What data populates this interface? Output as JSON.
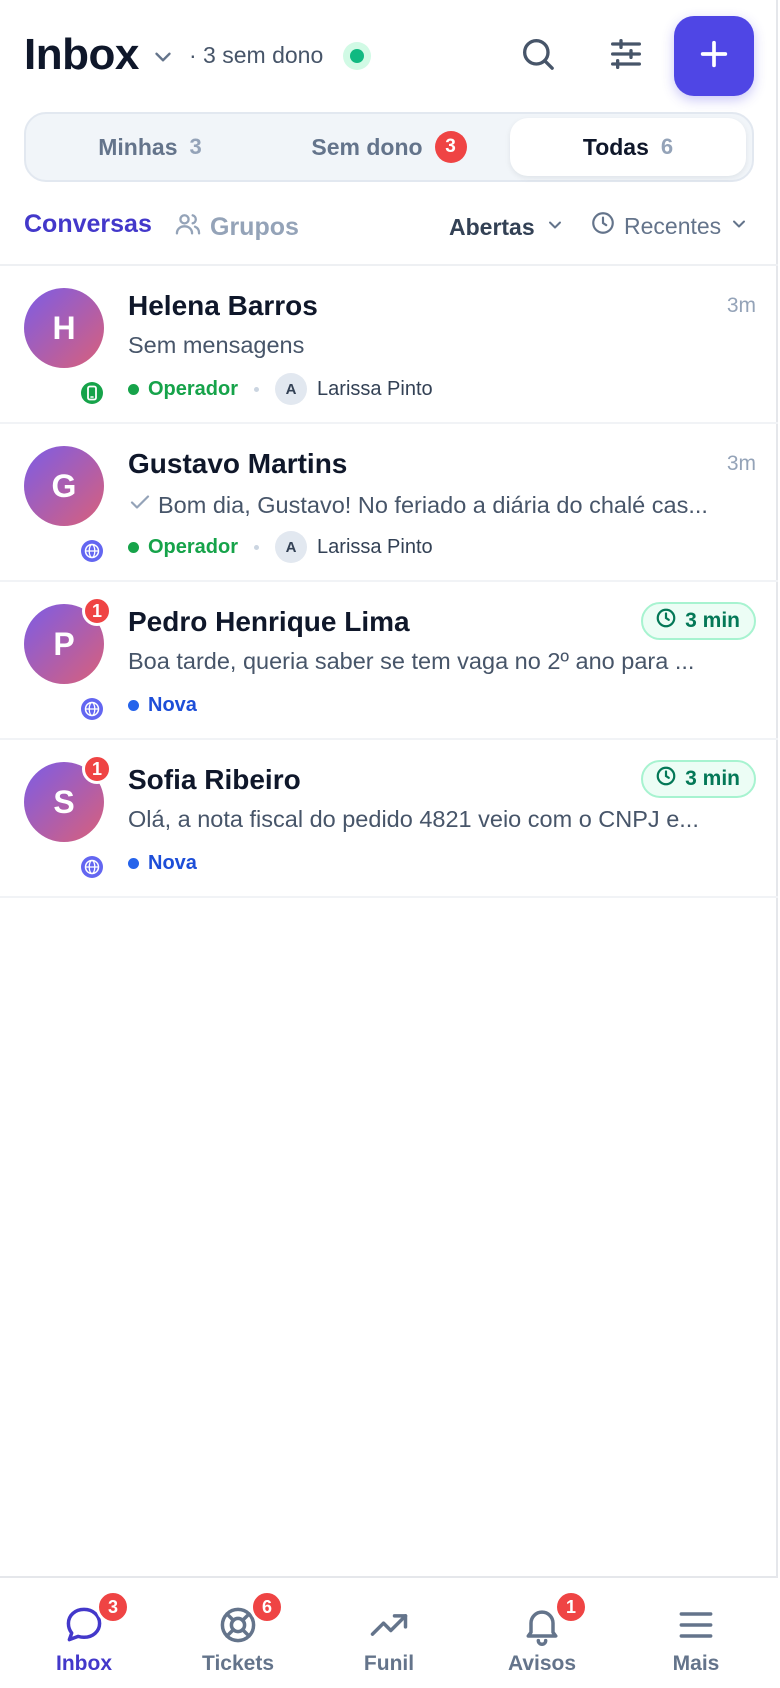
{
  "header": {
    "title": "Inbox",
    "unowned_summary": "· 3 sem dono",
    "status": "online",
    "accent_color": "#4f46e5"
  },
  "tabs": [
    {
      "label": "Minhas",
      "count": "3",
      "count_style": "plain",
      "selected": false
    },
    {
      "label": "Sem dono",
      "count": "3",
      "count_style": "badge",
      "selected": false
    },
    {
      "label": "Todas",
      "count": "6",
      "count_style": "plain",
      "selected": true
    }
  ],
  "subbar": {
    "conversations": "Conversas",
    "groups": "Grupos",
    "status_filter": "Abertas",
    "sort": "Recentes"
  },
  "conversations": [
    {
      "initial": "H",
      "name": "Helena Barros",
      "preview": "Sem mensagens",
      "preview_read_check": false,
      "time": "3m",
      "time_style": "plain",
      "unread": "",
      "channel": "whatsapp-icon",
      "status": "Operador",
      "status_color": "#16a34a",
      "agent_initial": "A",
      "agent_name": "Larissa Pinto"
    },
    {
      "initial": "G",
      "name": "Gustavo Martins",
      "preview": "Bom dia, Gustavo! No feriado a diária do chalé cas...",
      "preview_read_check": true,
      "time": "3m",
      "time_style": "plain",
      "unread": "",
      "channel": "globe-icon",
      "status": "Operador",
      "status_color": "#16a34a",
      "agent_initial": "A",
      "agent_name": "Larissa Pinto"
    },
    {
      "initial": "P",
      "name": "Pedro Henrique Lima",
      "preview": "Boa tarde, queria saber se tem vaga no 2º ano para ...",
      "preview_read_check": false,
      "time": "3 min",
      "time_style": "timer",
      "unread": "1",
      "channel": "globe-icon",
      "status": "Nova",
      "status_color": "#2563eb",
      "agent_initial": "",
      "agent_name": ""
    },
    {
      "initial": "S",
      "name": "Sofia Ribeiro",
      "preview": "Olá, a nota fiscal do pedido 4821 veio com o CNPJ e...",
      "preview_read_check": false,
      "time": "3 min",
      "time_style": "timer",
      "unread": "1",
      "channel": "globe-icon",
      "status": "Nova",
      "status_color": "#2563eb",
      "agent_initial": "",
      "agent_name": ""
    }
  ],
  "bottom_nav": [
    {
      "label": "Inbox",
      "icon": "chat-bubble-icon",
      "badge": "3",
      "active": true
    },
    {
      "label": "Tickets",
      "icon": "lifebuoy-icon",
      "badge": "6",
      "active": false
    },
    {
      "label": "Funil",
      "icon": "trending-up-icon",
      "badge": "",
      "active": false
    },
    {
      "label": "Avisos",
      "icon": "bell-icon",
      "badge": "1",
      "active": false
    },
    {
      "label": "Mais",
      "icon": "menu-icon",
      "badge": "",
      "active": false
    }
  ]
}
